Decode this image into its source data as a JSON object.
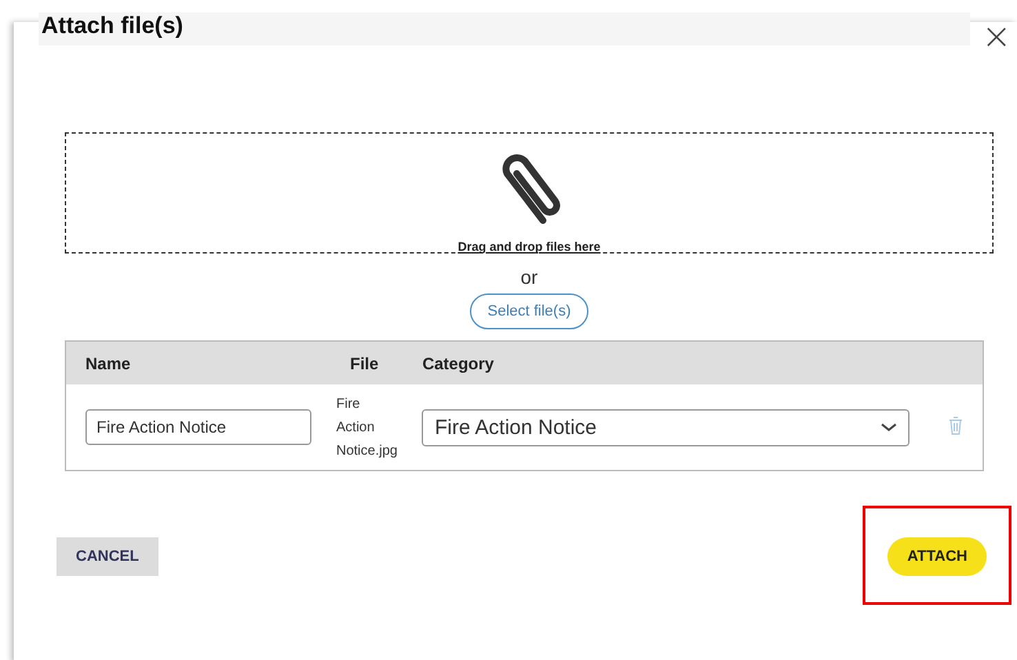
{
  "dialog": {
    "title": "Attach file(s)",
    "close": "×"
  },
  "dropzone": {
    "text": "Drag and drop files here",
    "or": "or",
    "select_button": "Select file(s)"
  },
  "table": {
    "columns": [
      "Name",
      "File",
      "Category"
    ],
    "rows": [
      {
        "name": "Fire Action Notice",
        "file": "Fire Action Notice.jpg",
        "category": "Fire Action Notice"
      }
    ]
  },
  "buttons": [
    {
      "kind": "secondary",
      "label": "CANCEL",
      "highlighted": false
    },
    {
      "kind": "primary",
      "label": "ATTACH",
      "highlighted": true
    }
  ]
}
